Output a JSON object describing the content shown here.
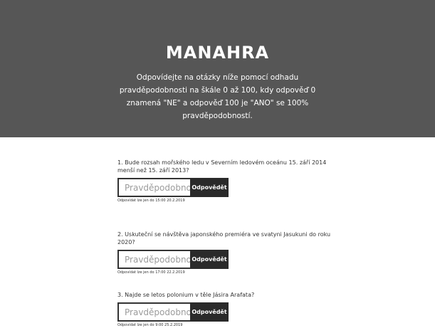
{
  "header": {
    "title": "MANAHRA",
    "description": "Odpovídejte na otázky níže pomocí odhadu pravděpodobnosti na škále 0 až 100, kdy odpověď 0 znamená \"NE\" a odpověď 100 je \"ANO\" se 100% pravděpodobností."
  },
  "questions": [
    {
      "text": "1. Bude rozsah mořského ledu v Severním ledovém oceánu 15. září 2014 menší než 15. září 2013?",
      "placeholder": "Pravděpodobnost",
      "button": "Odpovědět",
      "note": "Odpovídat lze jen do 15:00 20.2.2019"
    },
    {
      "text": "2. Uskuteční se návštěva japonského premiéra ve svatyni Jasukuni do roku 2020?",
      "placeholder": "Pravděpodobnost",
      "button": "Odpovědět",
      "note": "Odpovídat lze jen do 17:00 22.2.2019"
    },
    {
      "text": "3. Najde se letos polonium v těle Jásira Arafata?",
      "placeholder": "Pravděpodobnost",
      "button": "Odpovědět",
      "note": "Odpovídat lze jen do 9:00 25.2.2019"
    }
  ]
}
